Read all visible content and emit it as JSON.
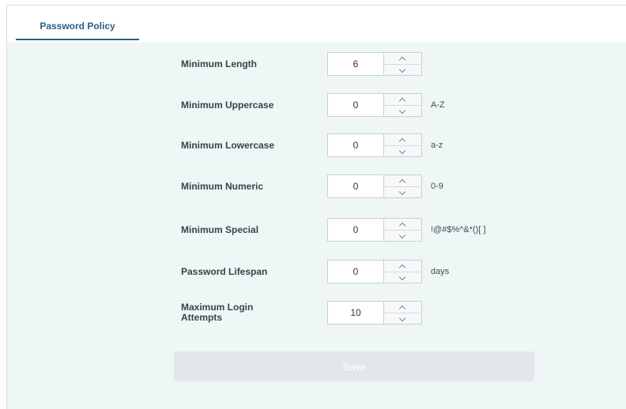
{
  "tabs": [
    {
      "label": "Password Policy",
      "active": true
    }
  ],
  "fields": [
    {
      "label": "Minimum Length",
      "value": "6",
      "hint": ""
    },
    {
      "label": "Minimum Uppercase",
      "value": "0",
      "hint": "A-Z"
    },
    {
      "label": "Minimum Lowercase",
      "value": "0",
      "hint": "a-z"
    },
    {
      "label": "Minimum Numeric",
      "value": "0",
      "hint": "0-9"
    },
    {
      "label": "Minimum Special",
      "value": "0",
      "hint": "!@#$%^&*()[ ]"
    },
    {
      "label": "Password Lifespan",
      "value": "0",
      "hint": "days"
    },
    {
      "label": "Maximum Login Attempts",
      "value": "10",
      "hint": ""
    }
  ],
  "icons": {
    "step_up": "chevron-up-icon",
    "step_down": "chevron-down-icon"
  },
  "save_button": {
    "label": "Save",
    "disabled": true
  },
  "colors": {
    "accent": "#2c5f86",
    "content_background": "#eef6f6",
    "button_disabled": "#e4e7e9"
  }
}
